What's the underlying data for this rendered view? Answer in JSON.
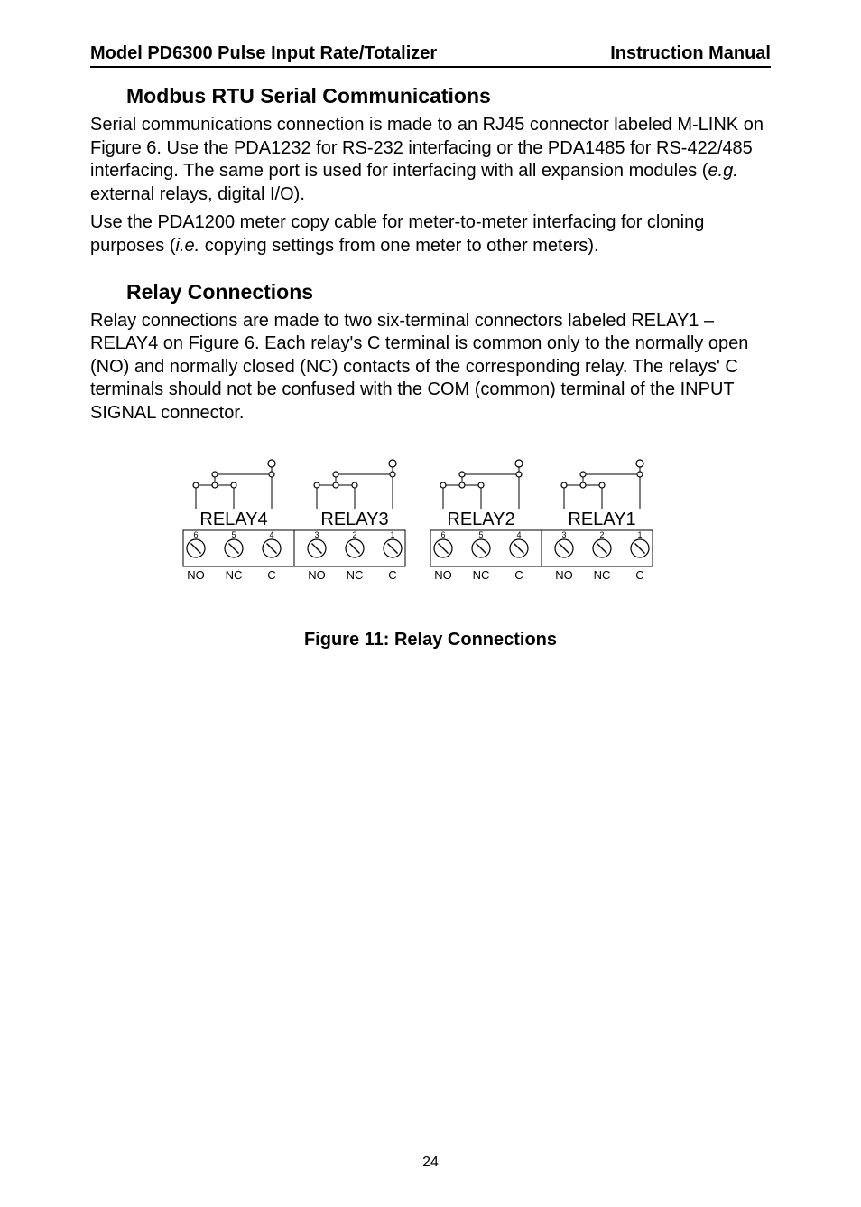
{
  "header": {
    "left": "Model PD6300 Pulse Input Rate/Totalizer",
    "right": "Instruction Manual"
  },
  "section1": {
    "title": "Modbus RTU Serial Communications",
    "para1_a": "Serial communications connection is made to an RJ45 connector labeled M-LINK on Figure 6. Use the PDA1232 for RS-232 interfacing or the PDA1485 for RS-422/485 interfacing. The same port is used for interfacing with all expansion modules (",
    "para1_em1": "e.g.",
    "para1_b": " external relays, digital I/O).",
    "para2_a": "Use the PDA1200 meter copy cable for meter-to-meter interfacing for cloning purposes (",
    "para2_em1": "i.e.",
    "para2_b": " copying settings from one meter to other meters)."
  },
  "section2": {
    "title": "Relay Connections",
    "para1": "Relay connections are made to two six-terminal connectors labeled RELAY1 – RELAY4 on Figure 6. Each relay's C terminal is common only to the normally open (NO) and normally closed (NC) contacts of the corresponding relay. The relays' C terminals should not be confused with the COM (common) terminal of the INPUT SIGNAL connector."
  },
  "diagram": {
    "blocks": [
      {
        "label": "RELAY4",
        "pins": [
          {
            "n": "6",
            "t": "NO"
          },
          {
            "n": "5",
            "t": "NC"
          },
          {
            "n": "4",
            "t": "C"
          }
        ]
      },
      {
        "label": "RELAY3",
        "pins": [
          {
            "n": "3",
            "t": "NO"
          },
          {
            "n": "2",
            "t": "NC"
          },
          {
            "n": "1",
            "t": "C"
          }
        ]
      },
      {
        "label": "RELAY2",
        "pins": [
          {
            "n": "6",
            "t": "NO"
          },
          {
            "n": "5",
            "t": "NC"
          },
          {
            "n": "4",
            "t": "C"
          }
        ]
      },
      {
        "label": "RELAY1",
        "pins": [
          {
            "n": "3",
            "t": "NO"
          },
          {
            "n": "2",
            "t": "NC"
          },
          {
            "n": "1",
            "t": "C"
          }
        ]
      }
    ]
  },
  "figure_caption": "Figure 11: Relay Connections",
  "page_number": "24"
}
